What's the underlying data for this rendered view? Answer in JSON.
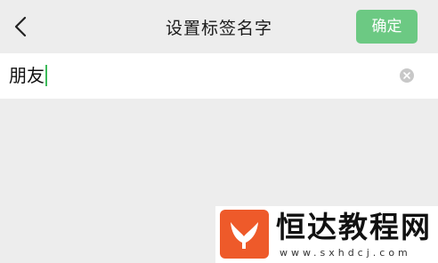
{
  "header": {
    "back_icon": "chevron-left-icon",
    "title": "设置标签名字",
    "confirm_label": "确定"
  },
  "tag_input": {
    "value": "朋友",
    "clear_icon": "clear-circle-icon"
  },
  "colors": {
    "background": "#ededed",
    "confirm_button": "#6cc983",
    "caret": "#3cba5a",
    "watermark_logo": "#ee5a2a"
  },
  "watermark": {
    "title": "恒达教程网",
    "url": "www.sxhdcj.com"
  }
}
